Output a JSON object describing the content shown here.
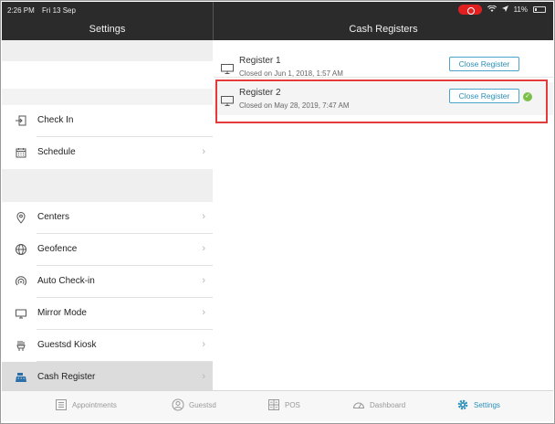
{
  "status_bar": {
    "time": "2:26 PM",
    "date": "Fri 13 Sep",
    "battery": "11%"
  },
  "nav": {
    "left_title": "Settings",
    "right_title": "Cash Registers"
  },
  "sidebar": {
    "items": [
      {
        "label": "Check In",
        "icon": "check-in-icon",
        "chevron": false
      },
      {
        "label": "Schedule",
        "icon": "calendar-icon",
        "chevron": true
      },
      {
        "label": "Centers",
        "icon": "location-pin-icon",
        "chevron": true
      },
      {
        "label": "Geofence",
        "icon": "globe-icon",
        "chevron": true
      },
      {
        "label": "Auto Check-in",
        "icon": "broadcast-icon",
        "chevron": true
      },
      {
        "label": "Mirror Mode",
        "icon": "monitor-icon",
        "chevron": true
      },
      {
        "label": "Guestsd Kiosk",
        "icon": "kiosk-icon",
        "chevron": true
      },
      {
        "label": "Cash Register",
        "icon": "cash-register-icon",
        "chevron": true,
        "selected": true
      }
    ]
  },
  "registers": [
    {
      "name": "Register 1",
      "closed": "Closed on Jun 1, 2018, 1:57 AM",
      "button": "Close Register",
      "active": false
    },
    {
      "name": "Register 2",
      "closed": "Closed on May 28, 2019, 7:47 AM",
      "button": "Close Register",
      "active": true
    }
  ],
  "tabs": [
    {
      "label": "Appointments",
      "icon": "list-icon"
    },
    {
      "label": "Guestsd",
      "icon": "person-icon"
    },
    {
      "label": "POS",
      "icon": "grid-icon"
    },
    {
      "label": "Dashboard",
      "icon": "gauge-icon"
    },
    {
      "label": "Settings",
      "icon": "gear-icon",
      "active": true
    }
  ],
  "colors": {
    "accent": "#2b8fb8",
    "highlight": "#e33b3b",
    "success": "#7cc04a"
  }
}
